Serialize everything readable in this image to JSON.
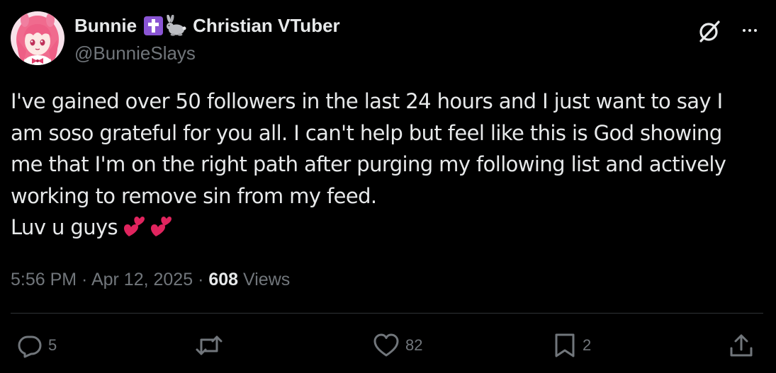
{
  "author": {
    "display_name": "Bunnie",
    "name_suffix": "Christian VTuber",
    "handle": "@BunnieSlays",
    "name_emojis": [
      "latin-cross-emoji",
      "rabbit-emoji"
    ]
  },
  "tweet": {
    "lines": [
      "I've gained over 50 followers in the last 24 hours and I just want to say I",
      "am soso grateful for you all. I can't help but feel like this is God showing",
      "me that I'm on the right path after purging my following list and actively",
      "working to remove sin from my feed.",
      "Luv u guys"
    ],
    "trailing_emoji": "two-hearts-emoji"
  },
  "meta": {
    "time": "5:56 PM",
    "separator": " · ",
    "date": "Apr 12, 2025",
    "views_count": "608",
    "views_label": " Views"
  },
  "actions": {
    "reply_count": "5",
    "repost_count": "",
    "like_count": "82",
    "bookmark_count": "2"
  },
  "colors": {
    "background": "#000000",
    "primary_text": "#e7e9ea",
    "secondary_text": "#71767b",
    "divider": "#2f3336",
    "cross_emoji_bg": "#8a55d4",
    "heart": "#e0245e"
  }
}
